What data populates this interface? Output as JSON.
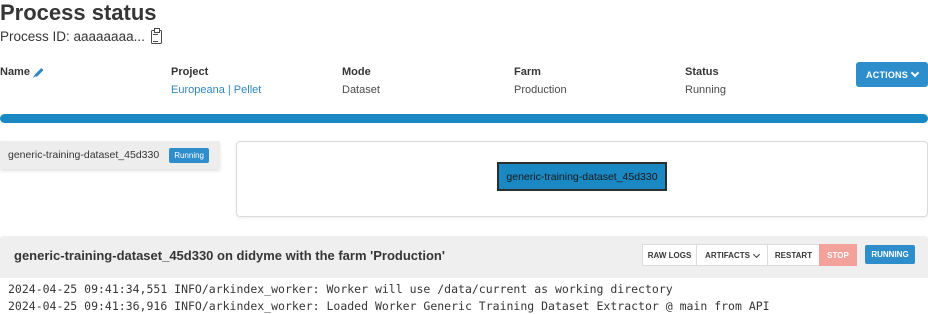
{
  "page": {
    "title": "Process status",
    "process_id_label": "Process ID: aaaaaaaa..."
  },
  "info": {
    "name_label": "Name",
    "project_label": "Project",
    "project_value": "Europeana | Pellet",
    "mode_label": "Mode",
    "mode_value": "Dataset",
    "farm_label": "Farm",
    "farm_value": "Production",
    "status_label": "Status",
    "status_value": "Running"
  },
  "actions_label": "ACTIONS",
  "progress": {
    "fraction": 1.0
  },
  "task": {
    "name": "generic-training-dataset_45d330",
    "badge": "Running"
  },
  "graph": {
    "node_label": "generic-training-dataset_45d330"
  },
  "logs": {
    "title": "generic-training-dataset_45d330 on didyme with the farm 'Production'",
    "buttons": {
      "raw_logs": "RAW LOGS",
      "artifacts": "ARTIFACTS",
      "restart": "RESTART",
      "stop": "STOP"
    },
    "status": "RUNNING",
    "lines": [
      "2024-04-25 09:41:34,551 INFO/arkindex_worker: Worker will use /data/current as working directory",
      "2024-04-25 09:41:36,916 INFO/arkindex_worker: Loaded Worker Generic Training Dataset Extractor @ main from API"
    ]
  },
  "colors": {
    "primary": "#2e8dcb",
    "progress": "#1a88c2",
    "stop": "#f2a19b",
    "link": "#2f86c4"
  }
}
